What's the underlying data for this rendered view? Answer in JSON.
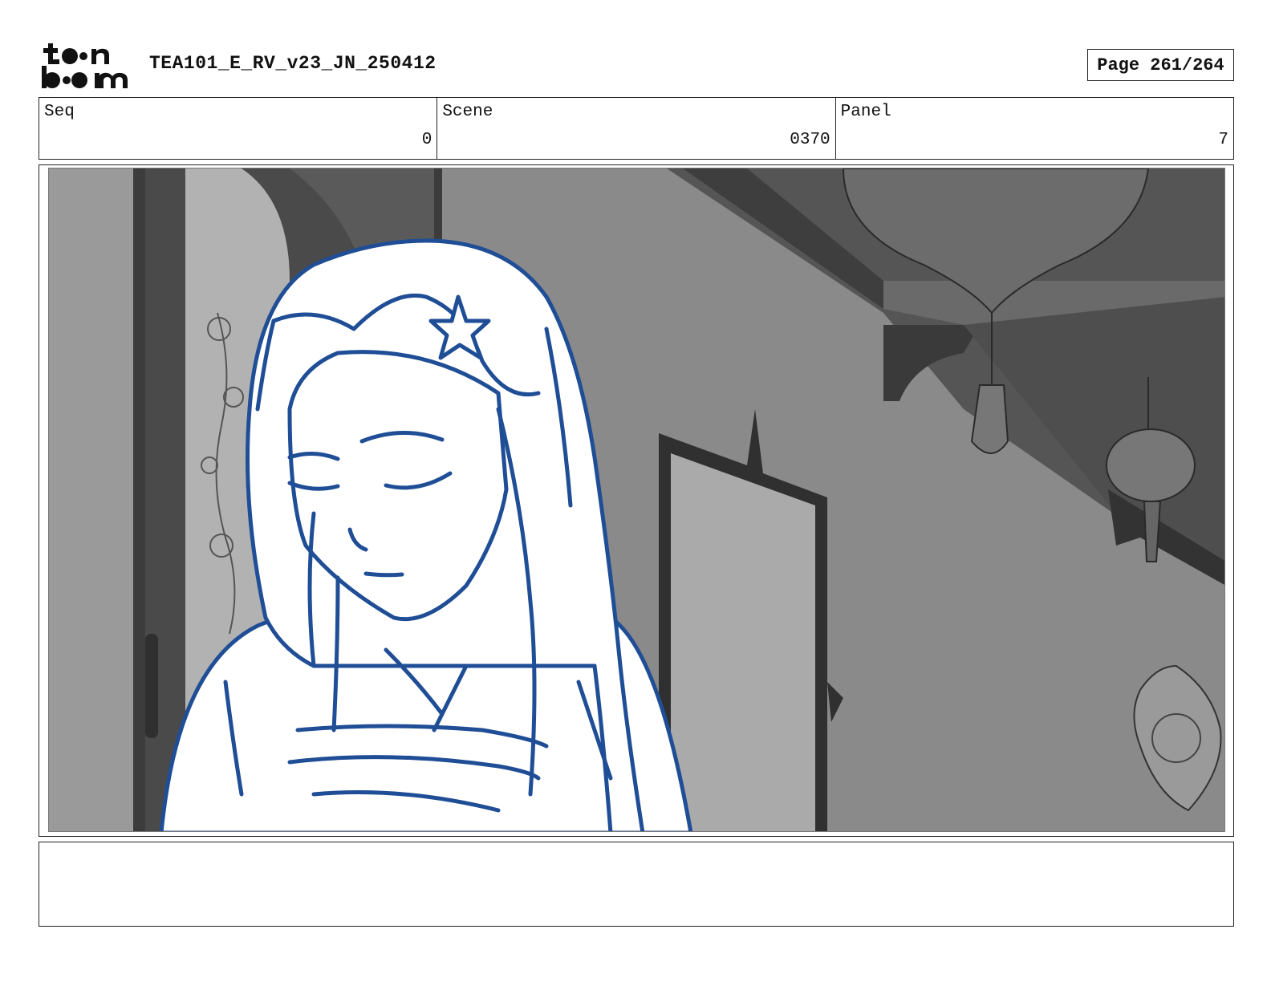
{
  "header": {
    "logo_text_top": "toon",
    "logo_text_bottom": "boom",
    "project_title": "TEA101_E_RV_v23_JN_250412",
    "page_label": "Page 261/264"
  },
  "info": {
    "seq_label": "Seq",
    "seq_value": "0",
    "scene_label": "Scene",
    "scene_value": "0370",
    "panel_label": "Panel",
    "panel_value": "7"
  },
  "panel": {
    "description_icon": "storyboard-drawing",
    "line_color": "#1f4e96"
  },
  "notes": {
    "text": ""
  }
}
